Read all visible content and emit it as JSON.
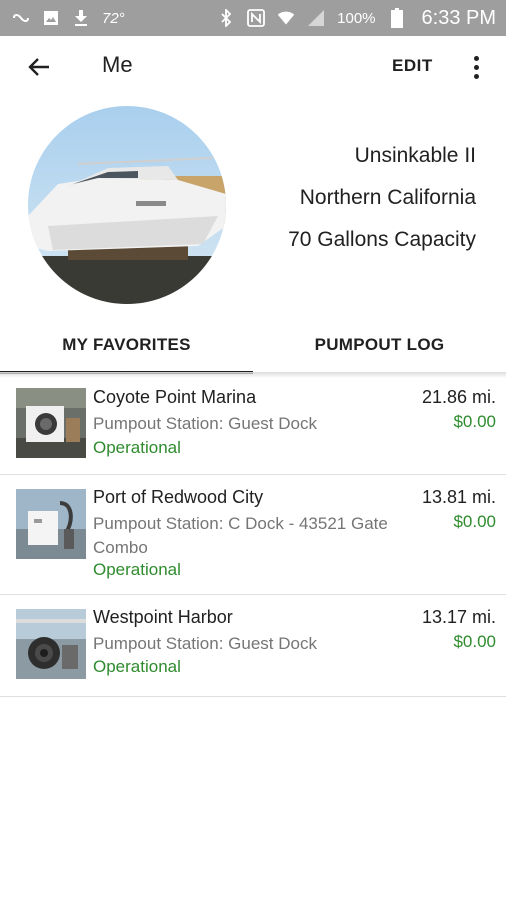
{
  "status_bar": {
    "temperature": "72°",
    "battery": "100%",
    "time": "6:33 PM"
  },
  "app_bar": {
    "title": "Me",
    "edit_label": "EDIT"
  },
  "profile": {
    "boat_name": "Unsinkable II",
    "region": "Northern California",
    "capacity": "70 Gallons Capacity"
  },
  "tabs": [
    {
      "label": "MY FAVORITES",
      "active": true
    },
    {
      "label": "PUMPOUT LOG",
      "active": false
    }
  ],
  "favorites": [
    {
      "name": "Coyote Point Marina",
      "subtitle": "Pumpout Station: Guest Dock",
      "status": "Operational",
      "distance": "21.86 mi.",
      "price": "$0.00"
    },
    {
      "name": "Port of Redwood City",
      "subtitle": "Pumpout Station: C Dock - 43521 Gate Combo",
      "status": "Operational",
      "distance": "13.81 mi.",
      "price": "$0.00"
    },
    {
      "name": "Westpoint Harbor",
      "subtitle": "Pumpout Station: Guest Dock",
      "status": "Operational",
      "distance": "13.17 mi.",
      "price": "$0.00"
    }
  ],
  "colors": {
    "status_bar": "#9e9e9e",
    "operational_green": "#2e8b2e",
    "price_green": "#2e8b2e",
    "divider": "#e0e0e0"
  }
}
